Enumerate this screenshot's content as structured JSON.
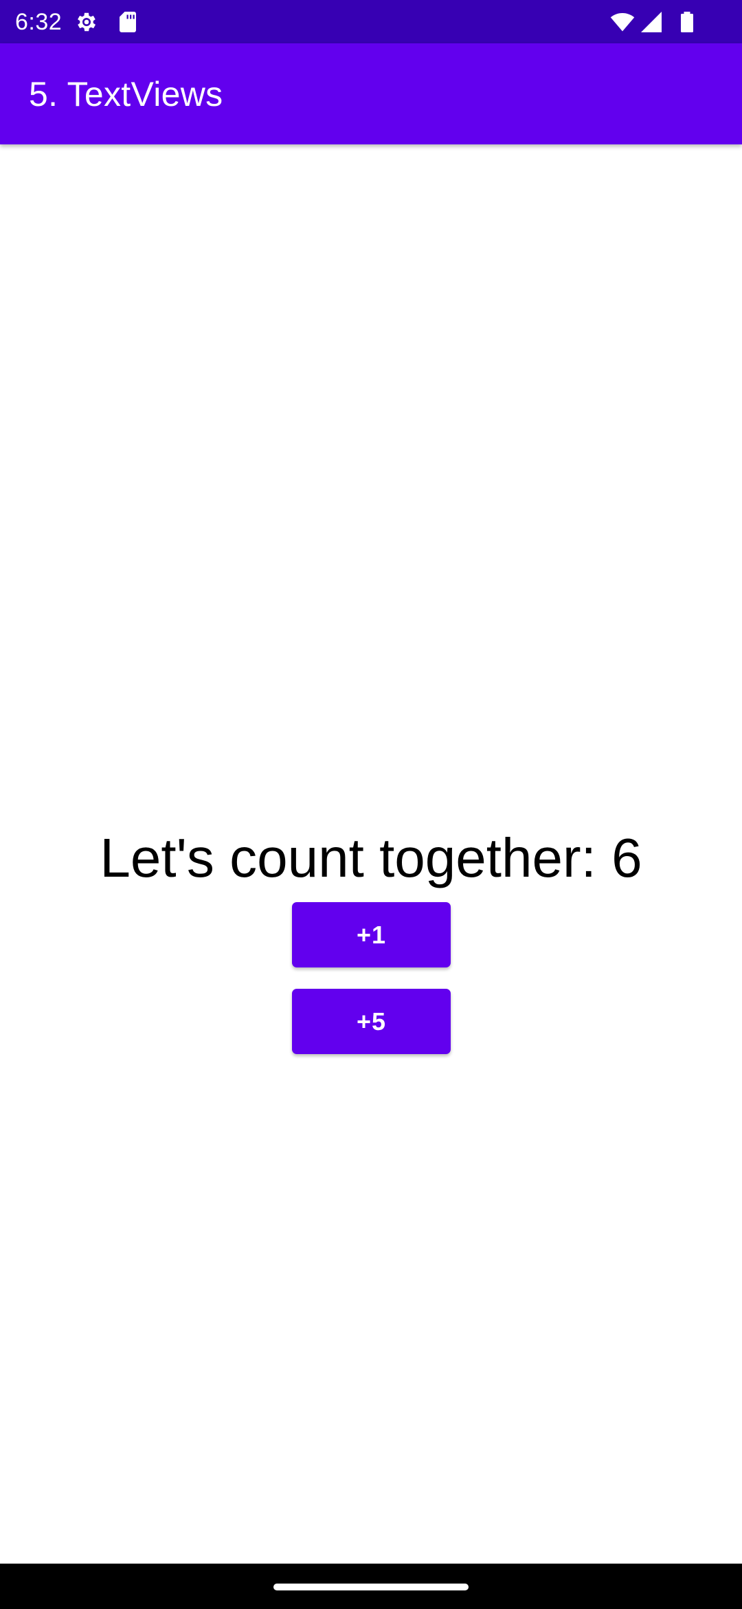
{
  "status_bar": {
    "time": "6:32",
    "left_icons": [
      "settings-gear-icon",
      "sd-card-icon"
    ],
    "right_icons": [
      "wifi-icon",
      "cellular-signal-icon",
      "battery-icon"
    ],
    "background_color": "#3700B3"
  },
  "app_bar": {
    "title": "5. TextViews",
    "background_color": "#6200EE"
  },
  "main": {
    "count_text": "Let's count together: 6",
    "buttons": [
      {
        "label": "+1"
      },
      {
        "label": "+5"
      }
    ],
    "button_color": "#6200EE"
  },
  "nav_bar": {
    "handle": "gesture-handle"
  }
}
